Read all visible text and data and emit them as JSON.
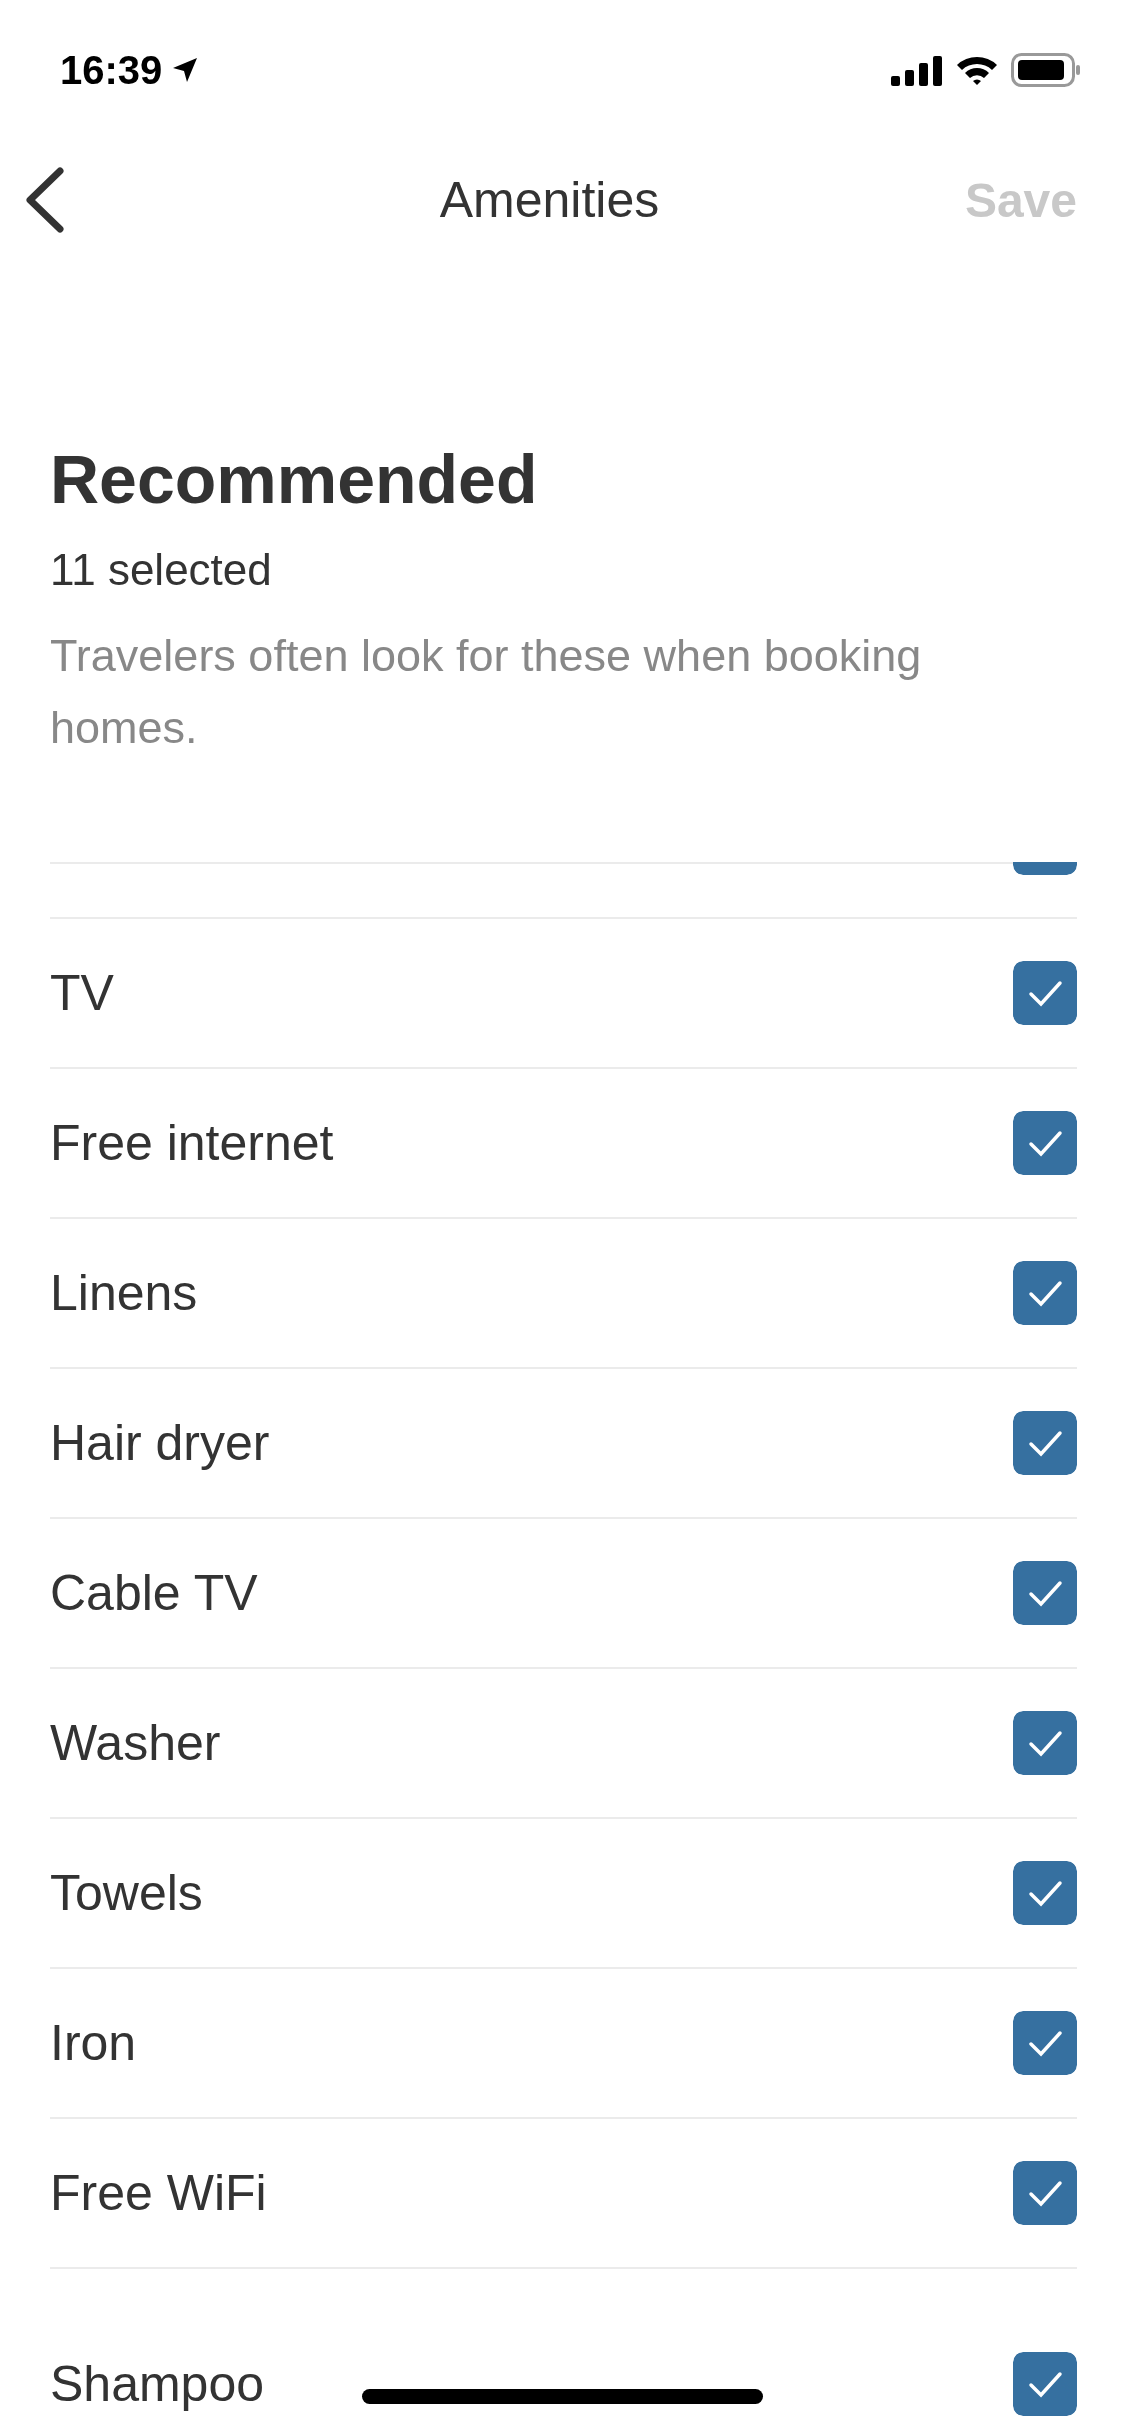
{
  "status_bar": {
    "time": "16:39"
  },
  "nav": {
    "title": "Amenities",
    "action": {
      "label": "Save",
      "disabled": true
    }
  },
  "section": {
    "title": "Recommended",
    "count": "11 selected",
    "description": "Travelers often look for these when booking homes."
  },
  "items": [
    {
      "checked": true
    },
    {
      "label": "TV",
      "checked": true
    },
    {
      "label": "Free internet",
      "checked": true
    },
    {
      "label": "Linens",
      "checked": true
    },
    {
      "label": "Hair dryer",
      "checked": true
    },
    {
      "label": "Cable TV",
      "checked": true
    },
    {
      "label": "Washer",
      "checked": true
    },
    {
      "label": "Towels",
      "checked": true
    },
    {
      "label": "Iron",
      "checked": true
    },
    {
      "label": "Free WiFi",
      "checked": true
    }
  ],
  "next_items": [
    {
      "label": "Shampoo",
      "checked": true
    }
  ]
}
